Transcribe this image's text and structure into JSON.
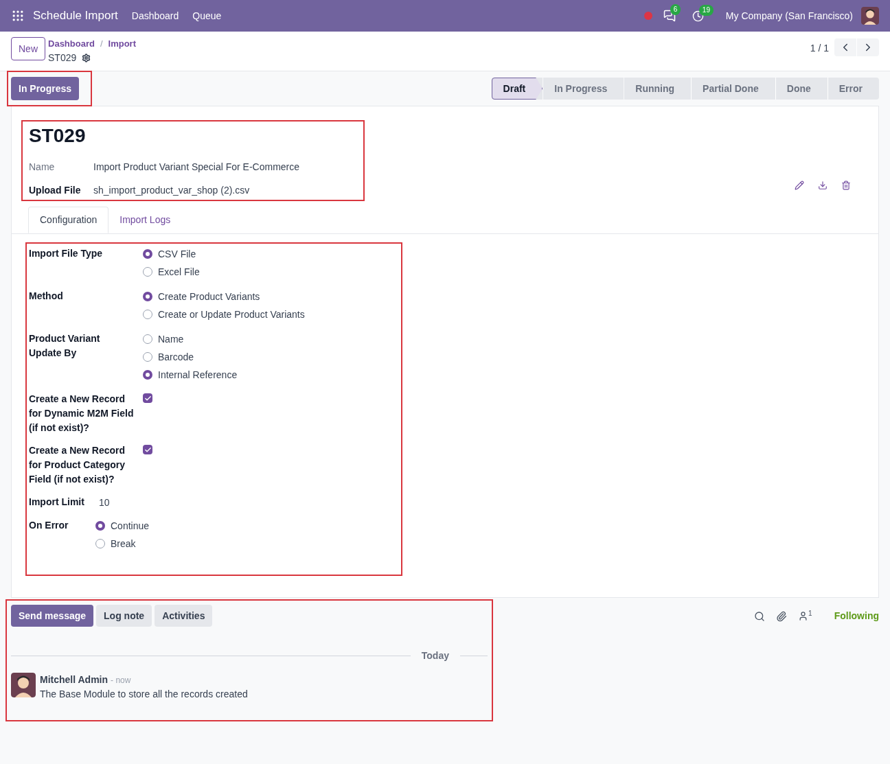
{
  "navbar": {
    "app_title": "Schedule Import",
    "menu": [
      "Dashboard",
      "Queue"
    ],
    "messages_count": "6",
    "activities_count": "19",
    "company": "My Company (San Francisco)"
  },
  "control_panel": {
    "new_button": "New",
    "breadcrumbs": [
      "Dashboard",
      "Import"
    ],
    "breadcrumb_separator": "/",
    "record": "ST029",
    "pager": "1 / 1"
  },
  "action_button": "In Progress",
  "statusbar": [
    {
      "label": "Draft",
      "selected": true
    },
    {
      "label": "In Progress",
      "selected": false
    },
    {
      "label": "Running",
      "selected": false
    },
    {
      "label": "Partial Done",
      "selected": false
    },
    {
      "label": "Done",
      "selected": false
    },
    {
      "label": "Error",
      "selected": false
    }
  ],
  "form": {
    "title": "ST029",
    "fields": [
      {
        "label": "Name",
        "required": false,
        "value": "Import Product Variant Special For E-Commerce"
      },
      {
        "label": "Upload File",
        "required": true,
        "value": "sh_import_product_var_shop (2).csv"
      }
    ],
    "tabs": [
      {
        "label": "Configuration",
        "selected": true
      },
      {
        "label": "Import Logs",
        "selected": false
      }
    ],
    "groups": [
      {
        "fields": [
          {
            "kind": "radio",
            "label": "Import File Type",
            "options": [
              {
                "label": "CSV File",
                "selected": true
              },
              {
                "label": "Excel File",
                "selected": false
              }
            ]
          },
          {
            "kind": "radio",
            "label": "Method",
            "options": [
              {
                "label": "Create Product Variants",
                "selected": true
              },
              {
                "label": "Create or Update Product Variants",
                "selected": false
              }
            ]
          },
          {
            "kind": "radio",
            "label": "Product Variant Update By",
            "options": [
              {
                "label": "Name",
                "selected": false
              },
              {
                "label": "Barcode",
                "selected": false
              },
              {
                "label": "Internal Reference",
                "selected": true
              }
            ]
          },
          {
            "kind": "checkbox",
            "label": "Create a New Record for Dynamic M2M Field (if not exist)?",
            "checked": true
          },
          {
            "kind": "checkbox",
            "label": "Create a New Record for Product Category Field (if not exist)?",
            "checked": true
          }
        ]
      },
      {
        "fields": [
          {
            "kind": "text",
            "label": "Import Limit",
            "value": "10"
          },
          {
            "kind": "radio",
            "label": "On Error",
            "options": [
              {
                "label": "Continue",
                "selected": true
              },
              {
                "label": "Break",
                "selected": false
              }
            ]
          }
        ]
      }
    ]
  },
  "chatter": {
    "buttons": [
      {
        "label": "Send message",
        "selected": true
      },
      {
        "label": "Log note",
        "selected": false
      },
      {
        "label": "Activities",
        "selected": false
      }
    ],
    "followers_count": "1",
    "follow": "Following",
    "date_separator": "Today",
    "messages": [
      {
        "author": "Mitchell Admin",
        "time": "- now",
        "body": "The Base Module to store all the records created"
      }
    ]
  }
}
